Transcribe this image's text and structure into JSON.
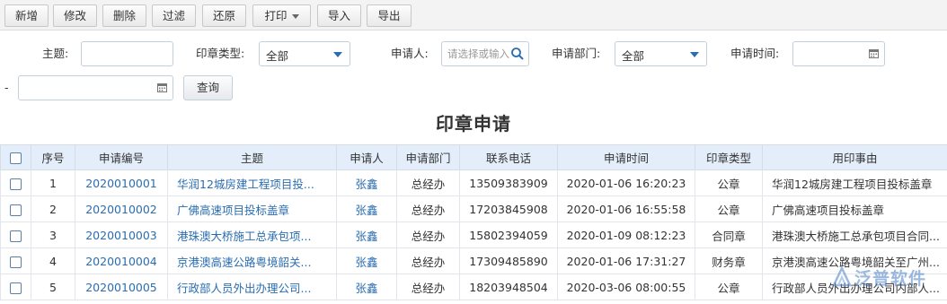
{
  "toolbar": {
    "add": "新增",
    "edit": "修改",
    "delete": "删除",
    "filter": "过滤",
    "restore": "还原",
    "print": "打印",
    "import": "导入",
    "export": "导出"
  },
  "query": {
    "subject_label": "主题:",
    "subject_value": "",
    "seal_type_label": "印章类型:",
    "seal_type_value": "全部",
    "applicant_label": "申请人:",
    "applicant_placeholder": "请选择或输入",
    "dept_label": "申请部门:",
    "dept_value": "全部",
    "time_label": "申请时间:",
    "time_from": "",
    "dash": "-",
    "time_to": "",
    "search_button": "查询"
  },
  "page_title": "印章申请",
  "table": {
    "columns": [
      "序号",
      "申请编号",
      "主题",
      "申请人",
      "申请部门",
      "联系电话",
      "申请时间",
      "印章类型",
      "用印事由"
    ],
    "rows": [
      {
        "seq": "1",
        "no": "2020010001",
        "subject": "华润12城房建工程项目投...",
        "applicant": "张鑫",
        "dept": "总经办",
        "phone": "13509383909",
        "time": "2020-01-06 16:20:23",
        "seal_type": "公章",
        "reason": "华润12城房建工程项目投标盖章"
      },
      {
        "seq": "2",
        "no": "2020010002",
        "subject": "广佛高速项目投标盖章",
        "applicant": "张鑫",
        "dept": "总经办",
        "phone": "17203845908",
        "time": "2020-01-06 16:55:58",
        "seal_type": "公章",
        "reason": "广佛高速项目投标盖章"
      },
      {
        "seq": "3",
        "no": "2020010003",
        "subject": "港珠澳大桥施工总承包项...",
        "applicant": "张鑫",
        "dept": "总经办",
        "phone": "15802394059",
        "time": "2020-01-09 08:12:23",
        "seal_type": "合同章",
        "reason": "港珠澳大桥施工总承包项目合同..."
      },
      {
        "seq": "4",
        "no": "2020010004",
        "subject": "京港澳高速公路粤境韶关...",
        "applicant": "张鑫",
        "dept": "总经办",
        "phone": "17309485890",
        "time": "2020-01-06 17:31:27",
        "seal_type": "财务章",
        "reason": "京港澳高速公路粤境韶关至广州..."
      },
      {
        "seq": "5",
        "no": "2020010005",
        "subject": "行政部人员外出办理公司...",
        "applicant": "张鑫",
        "dept": "总经办",
        "phone": "18203948504",
        "time": "2020-03-06 08:00:55",
        "seal_type": "公章",
        "reason": "行政部人员外出办理公司内部人..."
      }
    ]
  },
  "watermark": "泛普软件",
  "colors": {
    "link": "#2a6db0",
    "header_bg": "#e4eefa",
    "toolbar_bg": "#f3f3f3"
  }
}
